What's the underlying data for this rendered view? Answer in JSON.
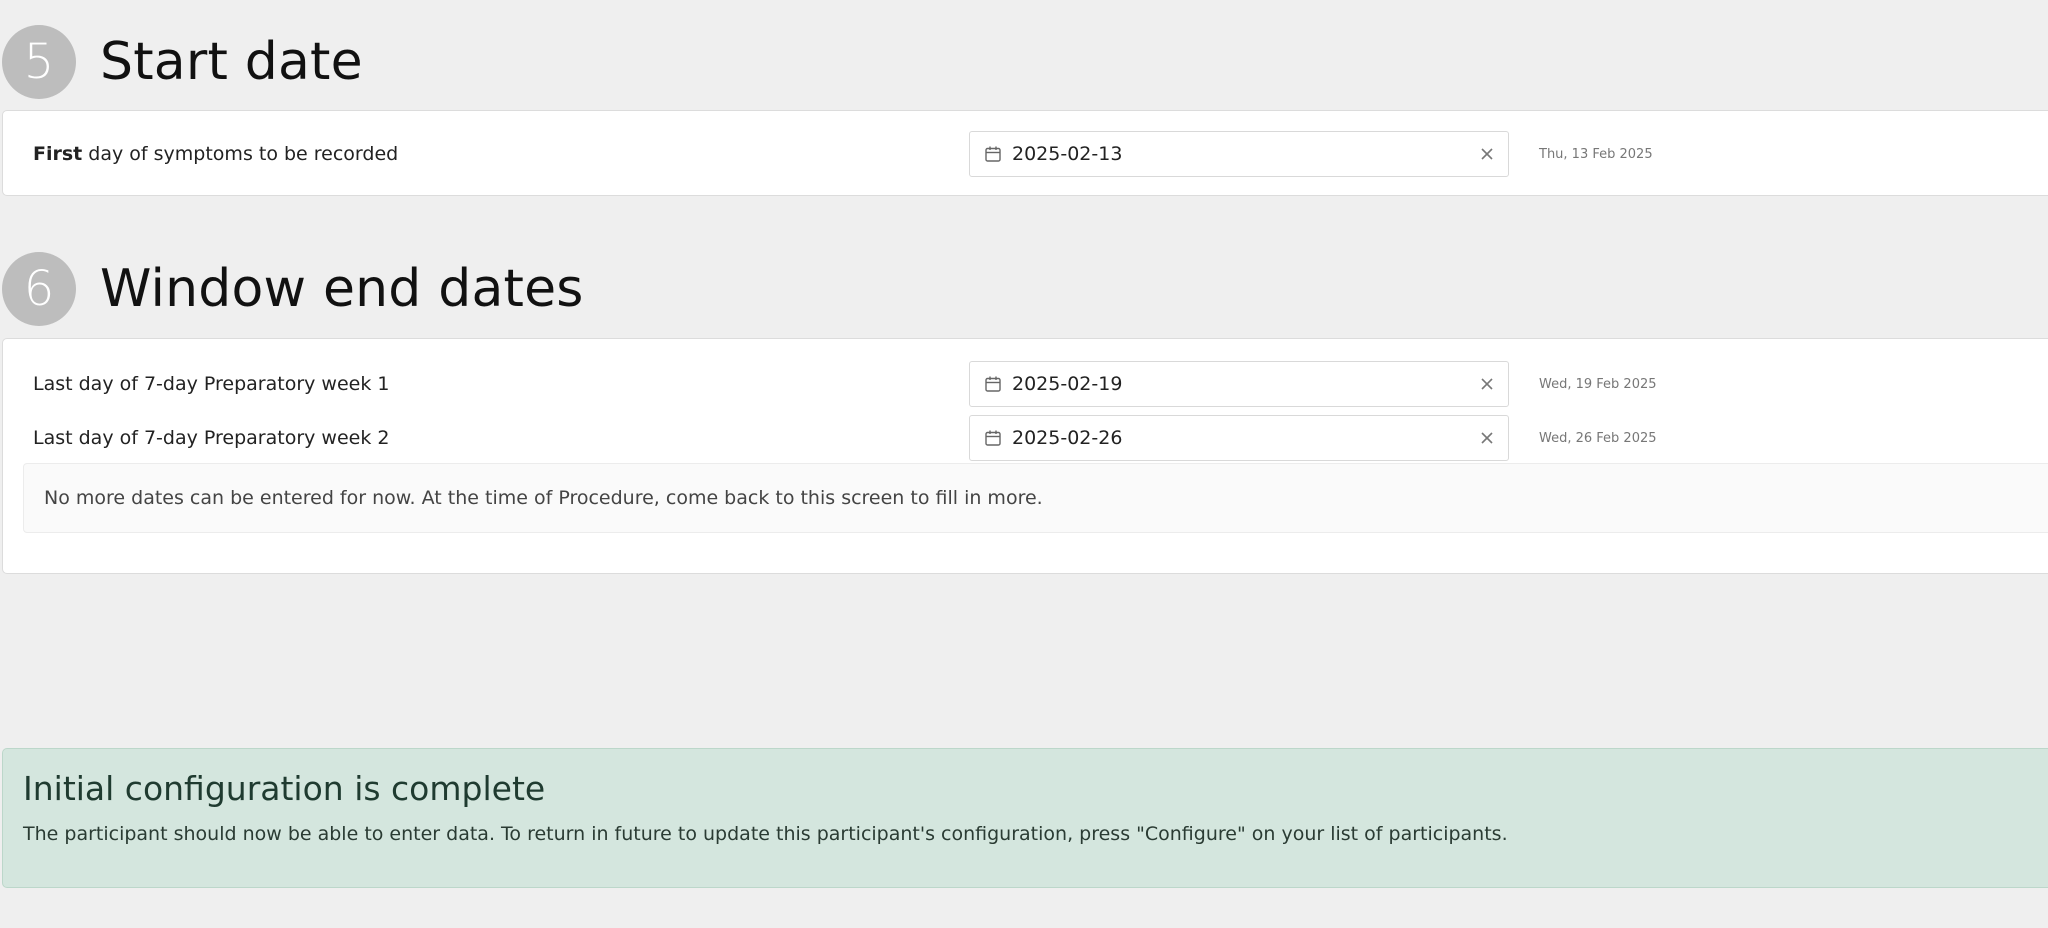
{
  "section5": {
    "number": "5",
    "title": "Start date",
    "row": {
      "label_bold": "First",
      "label_rest": " day of symptoms to be recorded",
      "value": "2025-02-13",
      "hint": "Thu, 13 Feb 2025"
    }
  },
  "section6": {
    "number": "6",
    "title": "Window end dates",
    "rows": [
      {
        "label": "Last day of 7-day Preparatory week 1",
        "value": "2025-02-19",
        "hint": "Wed, 19 Feb 2025"
      },
      {
        "label": "Last day of 7-day Preparatory week 2",
        "value": "2025-02-26",
        "hint": "Wed, 26 Feb 2025"
      }
    ],
    "notice": "No more dates can be entered for now. At the time of Procedure, come back to this screen to fill in more."
  },
  "completion": {
    "title": "Initial configuration is complete",
    "body": "The participant should now be able to enter data. To return in future to update this participant's configuration, press \"Configure\" on your list of participants."
  },
  "icons": {
    "date_field_icon": "calendar-icon",
    "clear_icon": "close-icon"
  },
  "colors": {
    "step_circle": "#bdbdbd",
    "success_background": "#d4e6de",
    "page_background": "#efefef"
  }
}
